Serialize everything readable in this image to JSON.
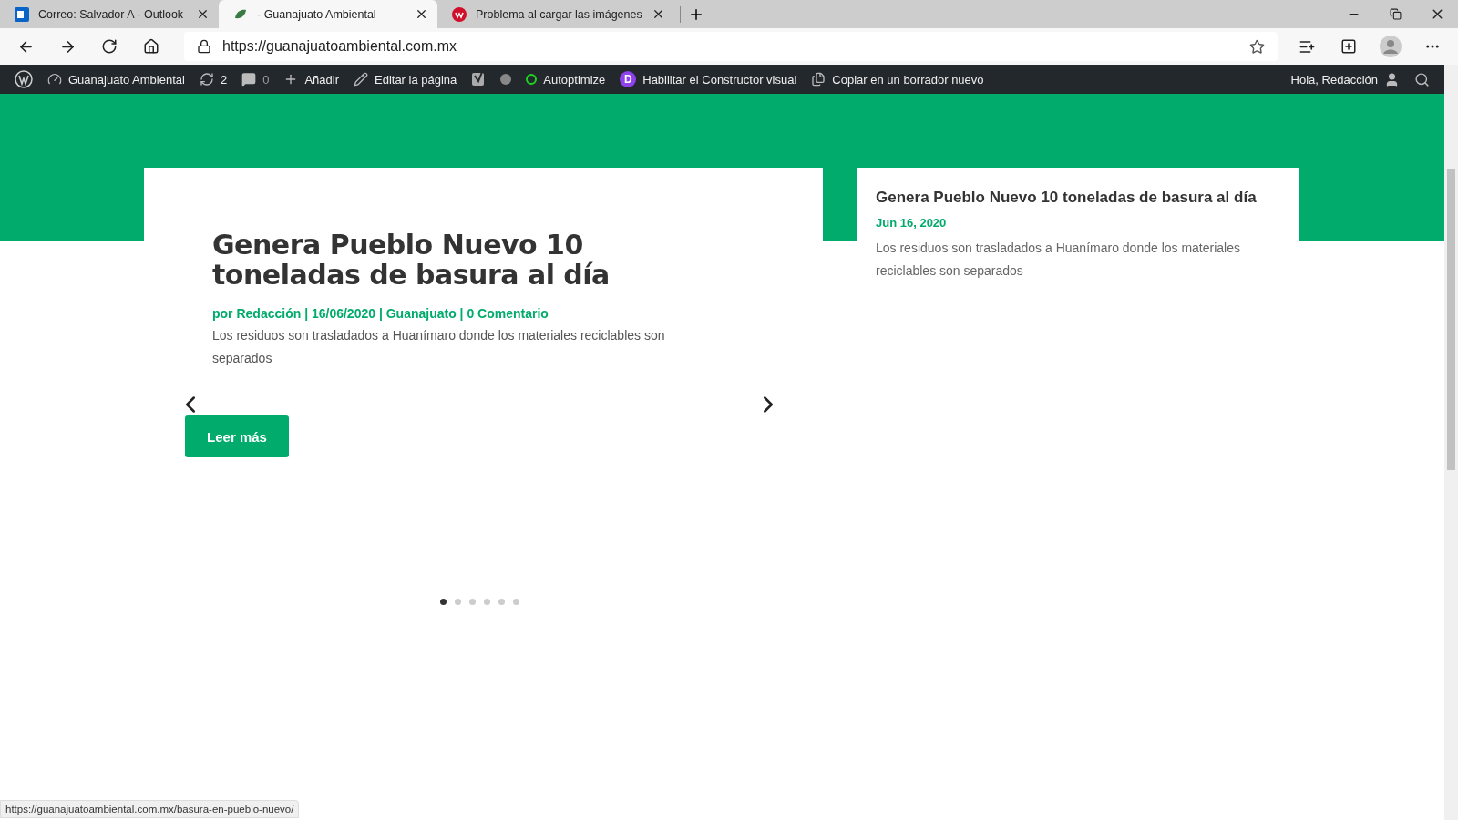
{
  "browser": {
    "tabs": [
      {
        "kind": "outlook",
        "title": "Correo: Salvador A - Outlook",
        "selected": false
      },
      {
        "kind": "site",
        "title": "- Guanajuato Ambiental",
        "selected": true
      },
      {
        "kind": "error",
        "title": "Problema al cargar las imágenes",
        "selected": false
      }
    ],
    "url": "https://guanajuatoambiental.com.mx"
  },
  "admin_bar": {
    "left": [
      {
        "kind": "wp"
      },
      {
        "kind": "site",
        "label": "Guanajuato Ambiental"
      },
      {
        "kind": "updates",
        "label": "2"
      },
      {
        "kind": "comments",
        "label": "0"
      },
      {
        "kind": "new",
        "label": "Añadir"
      },
      {
        "kind": "edit",
        "label": "Editar la página"
      },
      {
        "kind": "yoast"
      },
      {
        "kind": "status"
      },
      {
        "kind": "autoptimize",
        "label": "Autoptimize"
      },
      {
        "kind": "divi",
        "badge": "D",
        "label": "Habilitar el Constructor visual"
      },
      {
        "kind": "copy",
        "label": "Copiar en un borrador nuevo"
      }
    ],
    "greeting": "Hola, Redacción"
  },
  "featured": {
    "title": "Genera Pueblo Nuevo 10 toneladas de basura al día",
    "meta": "por Redacción | 16/06/2020 | Guanajuato | 0 Comentario",
    "excerpt": "Los residuos son trasladados a Huanímaro donde los materiales reciclables son separados",
    "button": "Leer más"
  },
  "slider_dots": [
    {
      "selected": true
    },
    {
      "selected": false
    },
    {
      "selected": false
    },
    {
      "selected": false
    },
    {
      "selected": false
    },
    {
      "selected": false
    }
  ],
  "side_post": {
    "title": "Genera Pueblo Nuevo 10 toneladas de basura al día",
    "date": "Jun 16, 2020",
    "excerpt": "Los residuos son trasladados a Huanímaro donde los materiales reciclables son separados"
  },
  "status_url": "https://guanajuatoambiental.com.mx/basura-en-pueblo-nuevo/"
}
